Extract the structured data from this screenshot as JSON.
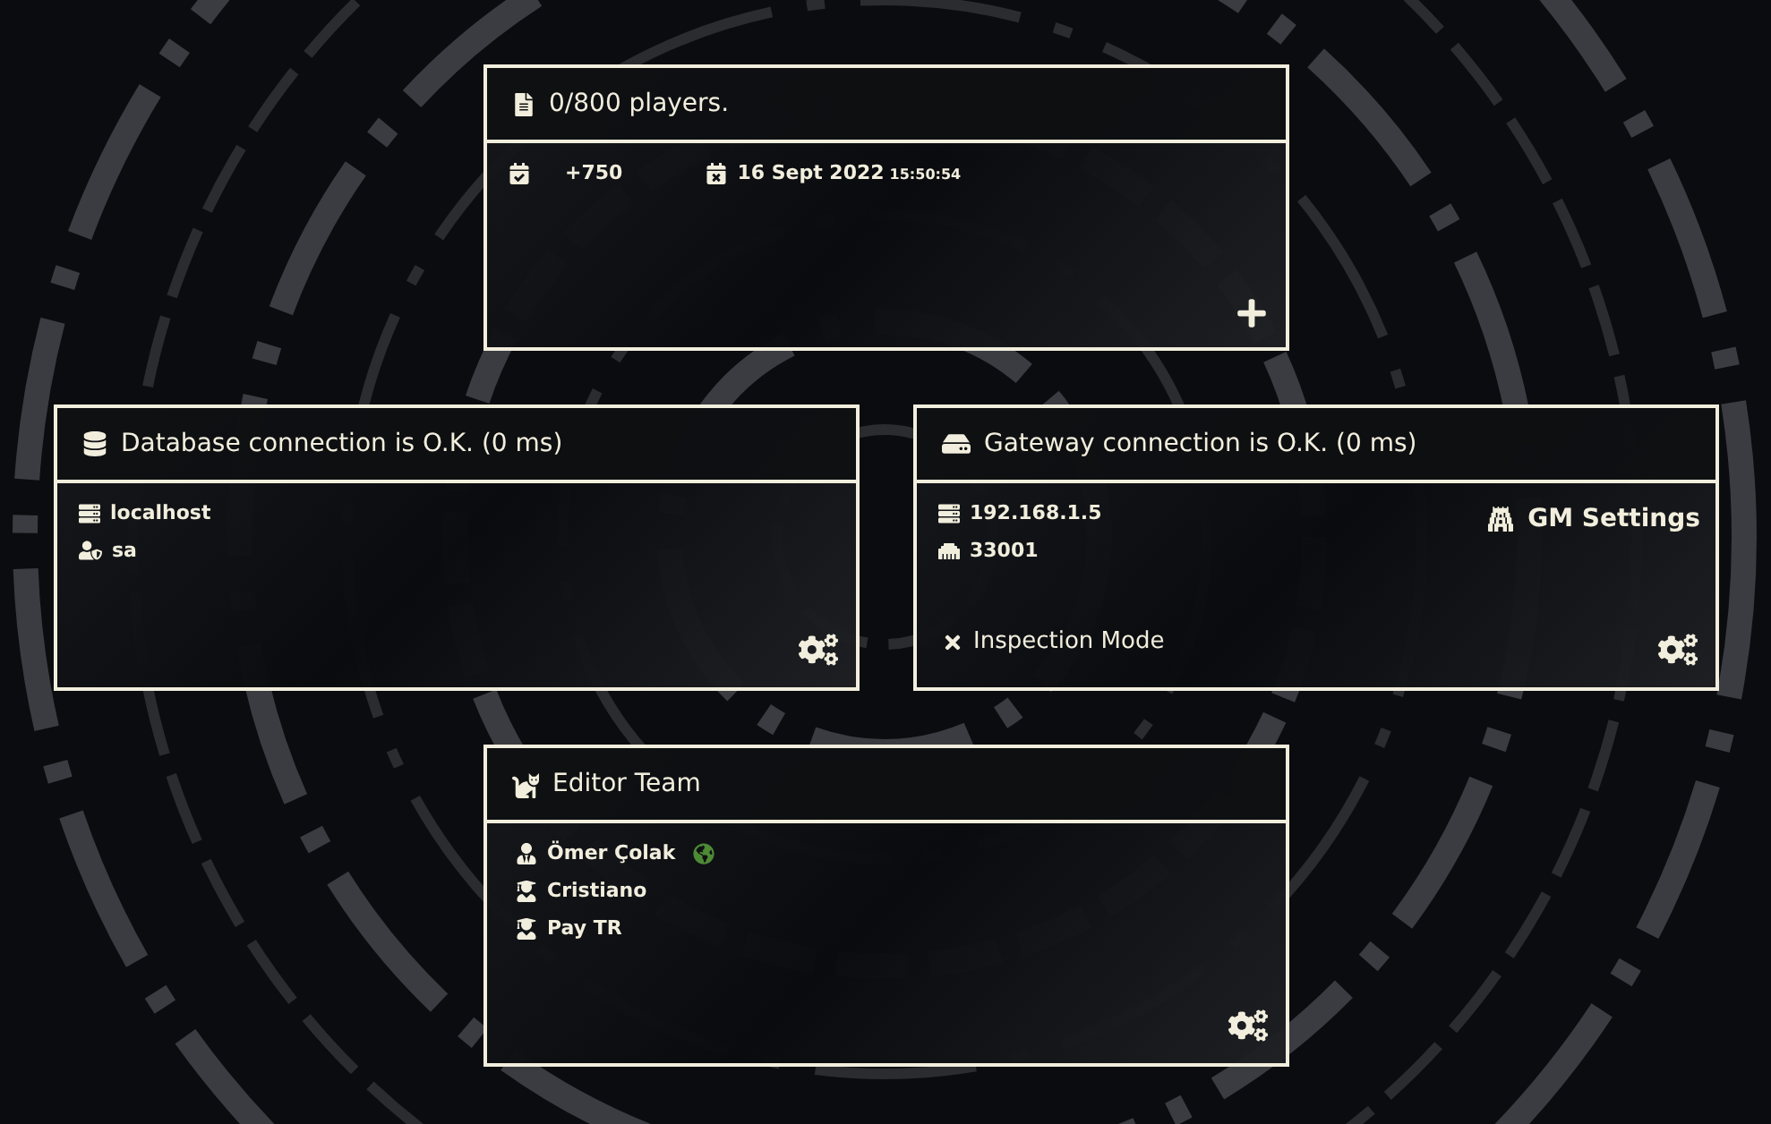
{
  "players_card": {
    "title": "0/800 players.",
    "stats": [
      {
        "kind": "checked",
        "text": "+750"
      },
      {
        "kind": "expires",
        "text": "16 Sept 2022",
        "time": "15:50:54"
      }
    ]
  },
  "database_card": {
    "title": "Database connection is O.K. (0 ms)",
    "items": [
      {
        "kind": "server",
        "text": "localhost"
      },
      {
        "kind": "user",
        "text": "sa"
      }
    ]
  },
  "gateway_card": {
    "title": "Gateway connection is O.K. (0 ms)",
    "items": [
      {
        "kind": "server",
        "text": "192.168.1.5"
      },
      {
        "kind": "port",
        "text": "33001"
      }
    ],
    "gm_settings": "GM Settings",
    "inspection_mode": {
      "label": "Inspection Mode",
      "on": false
    }
  },
  "editor_team": {
    "title": "Editor Team",
    "members": [
      {
        "kind": "admin",
        "name": "Ömer Çolak",
        "online": true
      },
      {
        "kind": "graduate",
        "name": "Cristiano",
        "online": false
      },
      {
        "kind": "graduate",
        "name": "Pay TR",
        "online": false
      }
    ]
  }
}
